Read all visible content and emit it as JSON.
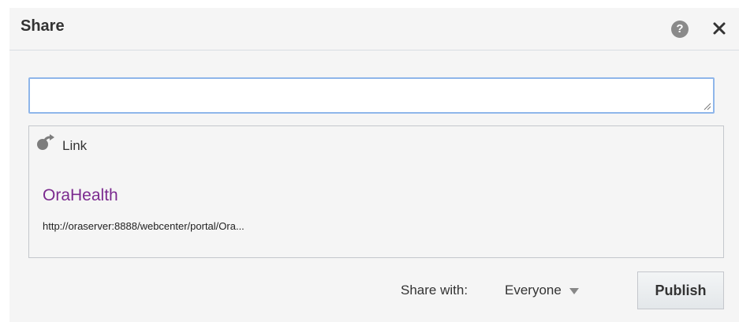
{
  "dialog": {
    "title": "Share",
    "help_icon": "help-icon",
    "help_glyph": "?",
    "close_icon": "close-icon"
  },
  "message": {
    "value": "",
    "placeholder": ""
  },
  "link": {
    "icon": "share-link-icon",
    "label": "Link",
    "title": "OraHealth",
    "url": "http://oraserver:8888/webcenter/portal/Ora..."
  },
  "share": {
    "label": "Share with:",
    "selected": "Everyone"
  },
  "actions": {
    "publish_label": "Publish"
  },
  "colors": {
    "link_title": "#7b2a8f",
    "input_focus_border": "#8fb6ea",
    "background": "#f5f5f5"
  }
}
